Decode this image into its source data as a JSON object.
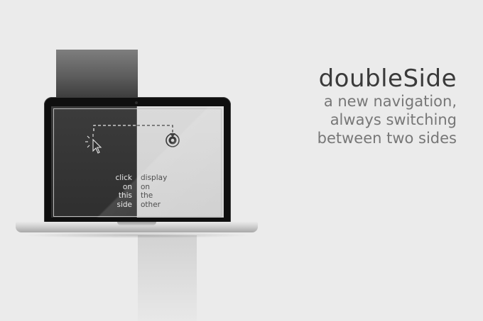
{
  "headline": {
    "title": "doubleSide",
    "subtitle_lines": [
      "a new navigation,",
      "always switching",
      "between two sides"
    ]
  },
  "screen": {
    "left_caption": [
      "click",
      "on",
      "this",
      "side"
    ],
    "right_caption": [
      "display",
      "on",
      "the",
      "other"
    ]
  },
  "icons": {
    "cursor": "mouse-pointer-icon",
    "target": "target-icon"
  },
  "colors": {
    "background": "#ebebeb",
    "title_text": "#3a3a3a",
    "subtitle_text": "#777777",
    "screen_dark": "#333333",
    "screen_light": "#d6d6d6"
  }
}
